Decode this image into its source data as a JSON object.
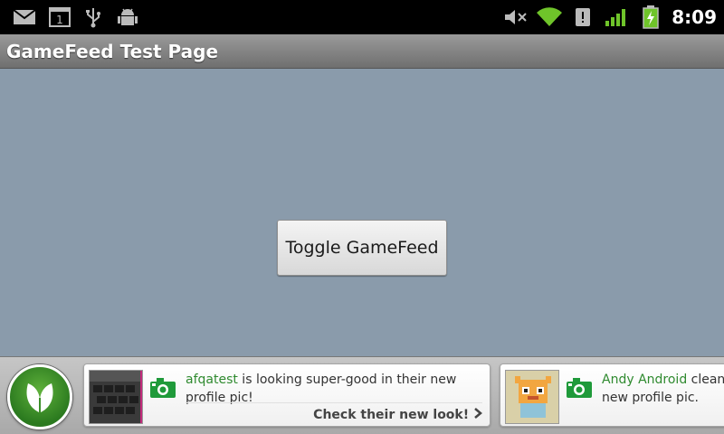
{
  "status_bar": {
    "time": "8:09",
    "left_icons": [
      "mail-icon",
      "calendar-icon",
      "usb-icon",
      "android-debug-icon"
    ],
    "calendar_day": "1",
    "right_icons": [
      "mute-icon",
      "wifi-icon",
      "alert-icon",
      "signal-icon",
      "battery-charging-icon"
    ]
  },
  "app": {
    "title": "GameFeed Test Page"
  },
  "main": {
    "toggle_button_label": "Toggle GameFeed"
  },
  "feed": {
    "logo_icon": "leaf-logo-icon",
    "cards": [
      {
        "user": "afqatest",
        "message_line1": " is looking super-good in their new",
        "message_line2": "profile pic!",
        "cta": "Check their new look!",
        "icon": "camera-icon"
      },
      {
        "user": "Andy Android",
        "message_line1": " clean",
        "message_line2": "new profile pic.",
        "icon": "camera-icon"
      }
    ]
  },
  "colors": {
    "content_bg": "#8a9bab",
    "accent_green": "#2f8a2f",
    "titlebar": "#8a8a8a"
  }
}
